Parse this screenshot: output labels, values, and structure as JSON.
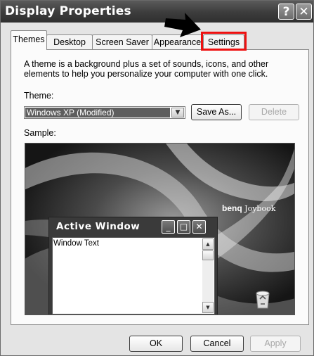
{
  "window": {
    "title": "Display Properties",
    "help_glyph": "?",
    "close_glyph": "✕"
  },
  "tabs": [
    {
      "label": "Themes",
      "active": true
    },
    {
      "label": "Desktop",
      "active": false
    },
    {
      "label": "Screen Saver",
      "active": false
    },
    {
      "label": "Appearance",
      "active": false
    },
    {
      "label": "Settings",
      "active": false
    }
  ],
  "themes_panel": {
    "description": "A theme is a background plus a set of sounds, icons, and other elements to help you personalize your computer with one click.",
    "theme_label": "Theme:",
    "theme_value": "Windows XP (Modified)",
    "save_as_label": "Save As...",
    "delete_label": "Delete",
    "sample_label": "Sample:"
  },
  "preview": {
    "active_window_title": "Active Window",
    "window_text": "Window Text",
    "brand_bold": "benq",
    "brand_light": "Joybook"
  },
  "footer": {
    "ok_label": "OK",
    "cancel_label": "Cancel",
    "apply_label": "Apply"
  },
  "annotations": {
    "highlight_color": "#e11111",
    "arrow_color": "#000000"
  }
}
